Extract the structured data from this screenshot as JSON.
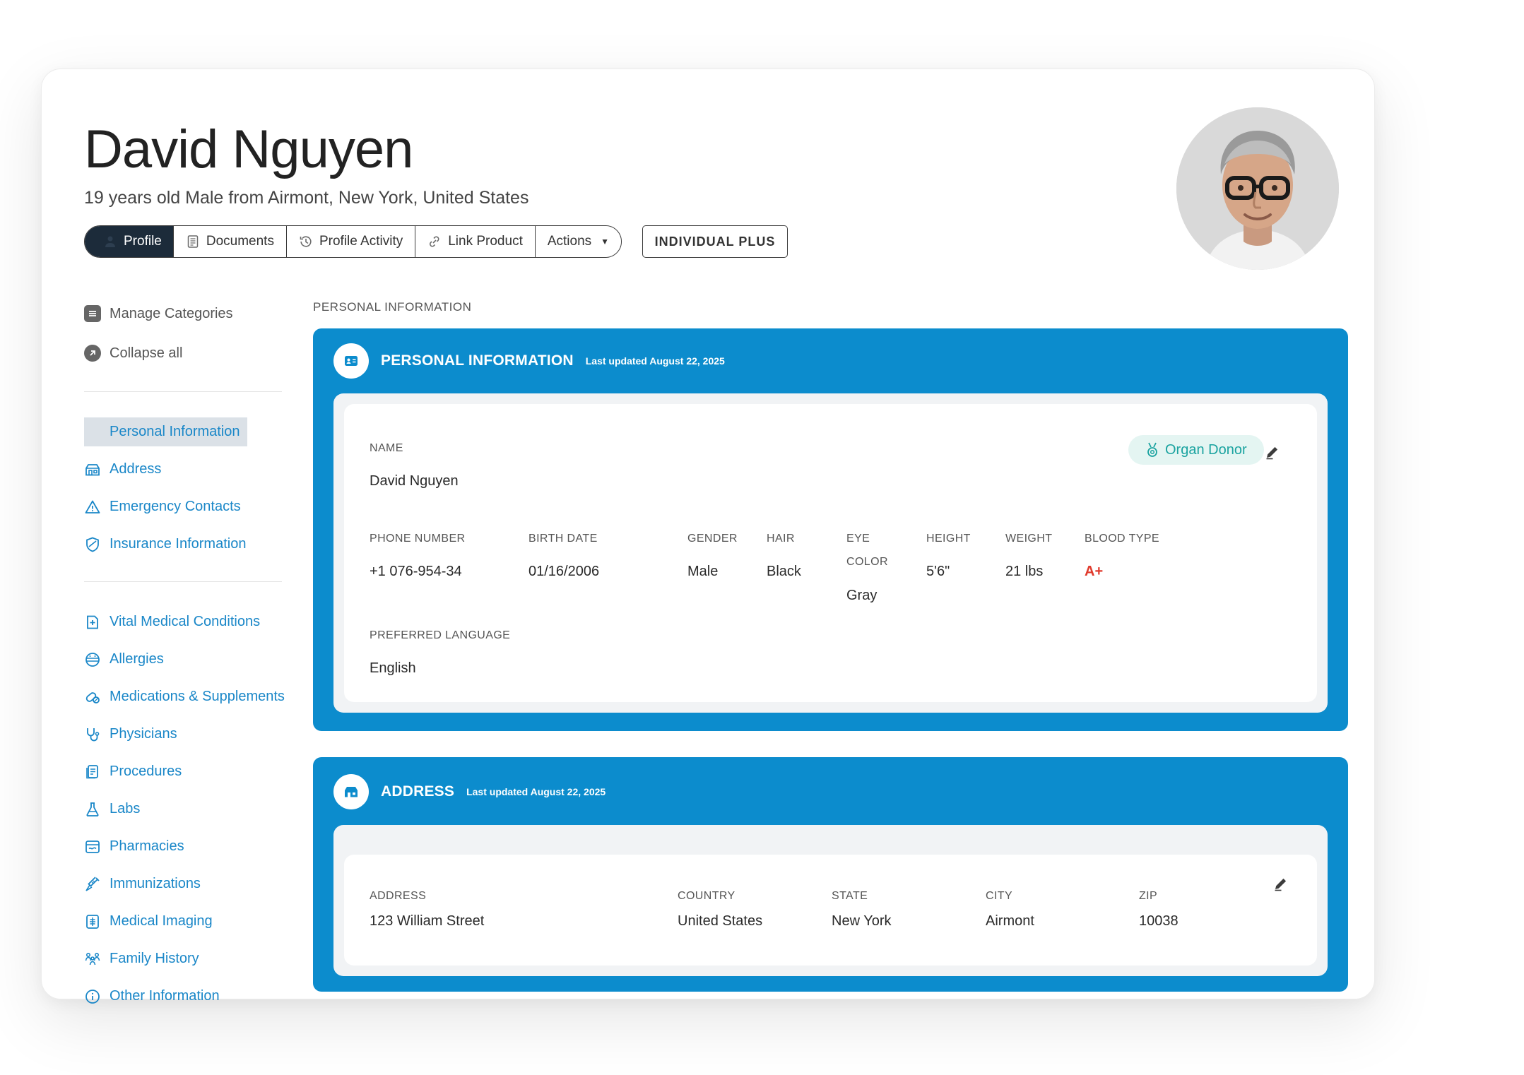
{
  "profile": {
    "name": "David Nguyen",
    "subtitle": "19 years old Male from Airmont, New York, United States"
  },
  "tabs": [
    {
      "label": "Profile",
      "icon": "user-icon",
      "active": true
    },
    {
      "label": "Documents",
      "icon": "document-icon"
    },
    {
      "label": "Profile Activity",
      "icon": "history-icon"
    },
    {
      "label": "Link Product",
      "icon": "link-icon"
    },
    {
      "label": "Actions",
      "icon": "caret-down-icon"
    }
  ],
  "plan_button": "INDIVIDUAL PLUS",
  "sidebar": {
    "manage": "Manage Categories",
    "collapse": "Collapse all",
    "group1": [
      {
        "label": "Personal Information",
        "icon": "id-card-icon",
        "active": true
      },
      {
        "label": "Address",
        "icon": "address-icon"
      },
      {
        "label": "Emergency Contacts",
        "icon": "warning-icon"
      },
      {
        "label": "Insurance Information",
        "icon": "shield-icon"
      }
    ],
    "group2": [
      {
        "label": "Vital Medical Conditions",
        "icon": "medical-conditions-icon"
      },
      {
        "label": "Allergies",
        "icon": "allergy-icon"
      },
      {
        "label": "Medications & Supplements",
        "icon": "pills-icon"
      },
      {
        "label": "Physicians",
        "icon": "stethoscope-icon"
      },
      {
        "label": "Procedures",
        "icon": "procedure-icon"
      },
      {
        "label": "Labs",
        "icon": "flask-icon"
      },
      {
        "label": "Pharmacies",
        "icon": "pharmacy-icon"
      },
      {
        "label": "Immunizations",
        "icon": "syringe-icon"
      },
      {
        "label": "Medical Imaging",
        "icon": "xray-icon"
      },
      {
        "label": "Family History",
        "icon": "family-icon"
      },
      {
        "label": "Other Information",
        "icon": "info-icon"
      }
    ]
  },
  "section_label": "PERSONAL INFORMATION",
  "personal": {
    "title": "PERSONAL INFORMATION",
    "updated": "Last updated August 22, 2025",
    "badge": "Organ Donor",
    "name_label": "NAME",
    "name_value": "David Nguyen",
    "phone_label": "PHONE NUMBER",
    "phone_value": "+1 076-954-34",
    "birth_label": "BIRTH DATE",
    "birth_value": "01/16/2006",
    "gender_label": "GENDER",
    "gender_value": "Male",
    "hair_label": "HAIR",
    "hair_value": "Black",
    "eye_label_1": "EYE",
    "eye_label_2": "COLOR",
    "eye_value": "Gray",
    "height_label": "HEIGHT",
    "height_value": "5'6\"",
    "weight_label": "WEIGHT",
    "weight_value": "21 lbs",
    "blood_label": "BLOOD TYPE",
    "blood_value": "A+",
    "lang_label": "PREFERRED LANGUAGE",
    "lang_value": "English"
  },
  "address": {
    "title": "ADDRESS",
    "updated": "Last updated August 22, 2025",
    "address_label": "ADDRESS",
    "address_value": "123 William Street",
    "country_label": "COUNTRY",
    "country_value": "United States",
    "state_label": "STATE",
    "state_value": "New York",
    "city_label": "CITY",
    "city_value": "Airmont",
    "zip_label": "ZIP",
    "zip_value": "10038"
  },
  "colors": {
    "primary": "#0c8ccd",
    "link": "#1a87c8",
    "blood_type": "#e03a2c",
    "badge_text": "#1aa3a0",
    "badge_bg": "#e4f5f2",
    "active_tab": "#1c2b3a"
  }
}
